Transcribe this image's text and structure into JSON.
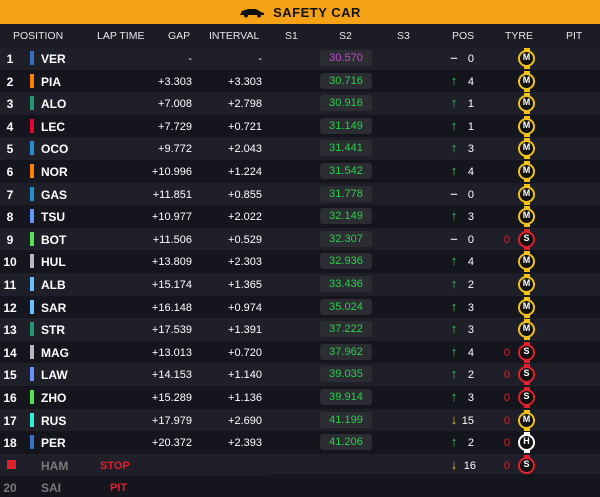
{
  "banner": {
    "icon": "safety-car-icon",
    "title": "SAFETY CAR"
  },
  "header": {
    "position": "POSITION",
    "lap_time": "LAP TIME",
    "gap": "GAP",
    "interval": "INTERVAL",
    "s1": "S1",
    "s2": "S2",
    "s3": "S3",
    "pos": "POS",
    "tyre": "TYRE",
    "pit": "PIT"
  },
  "colors": {
    "banner": "#f5a216",
    "purple": "#c24ad6",
    "green": "#29d14b",
    "medium": "#f2c21b",
    "soft": "#e0202a",
    "hard": "#ffffff"
  },
  "rows": [
    {
      "pos": "1",
      "driver": "VER",
      "team_color": "#3671c6",
      "gap": "-",
      "interval": "-",
      "s2": "30.570",
      "s2_type": "purple",
      "arrow": "none",
      "pos_change": "0",
      "tyre": "M",
      "tyre_age": ""
    },
    {
      "pos": "2",
      "driver": "PIA",
      "team_color": "#ff8000",
      "gap": "+3.303",
      "interval": "+3.303",
      "s2": "30.716",
      "s2_type": "green",
      "arrow": "up",
      "pos_change": "4",
      "tyre": "M",
      "tyre_age": ""
    },
    {
      "pos": "3",
      "driver": "ALO",
      "team_color": "#229971",
      "gap": "+7.008",
      "interval": "+2.798",
      "s2": "30.916",
      "s2_type": "green",
      "arrow": "up",
      "pos_change": "1",
      "tyre": "M",
      "tyre_age": ""
    },
    {
      "pos": "4",
      "driver": "LEC",
      "team_color": "#e8002d",
      "gap": "+7.729",
      "interval": "+0.721",
      "s2": "31.149",
      "s2_type": "green",
      "arrow": "up",
      "pos_change": "1",
      "tyre": "M",
      "tyre_age": ""
    },
    {
      "pos": "5",
      "driver": "OCO",
      "team_color": "#2293d1",
      "gap": "+9.772",
      "interval": "+2.043",
      "s2": "31.441",
      "s2_type": "green",
      "arrow": "up",
      "pos_change": "3",
      "tyre": "M",
      "tyre_age": ""
    },
    {
      "pos": "6",
      "driver": "NOR",
      "team_color": "#ff8000",
      "gap": "+10.996",
      "interval": "+1.224",
      "s2": "31.542",
      "s2_type": "green",
      "arrow": "up",
      "pos_change": "4",
      "tyre": "M",
      "tyre_age": ""
    },
    {
      "pos": "7",
      "driver": "GAS",
      "team_color": "#2293d1",
      "gap": "+11.851",
      "interval": "+0.855",
      "s2": "31.778",
      "s2_type": "green",
      "arrow": "none",
      "pos_change": "0",
      "tyre": "M",
      "tyre_age": ""
    },
    {
      "pos": "8",
      "driver": "TSU",
      "team_color": "#6692ff",
      "gap": "+10.977",
      "interval": "+2.022",
      "s2": "32.149",
      "s2_type": "green",
      "arrow": "up",
      "pos_change": "3",
      "tyre": "M",
      "tyre_age": ""
    },
    {
      "pos": "9",
      "driver": "BOT",
      "team_color": "#52e252",
      "gap": "+11.506",
      "interval": "+0.529",
      "s2": "32.307",
      "s2_type": "green",
      "arrow": "none",
      "pos_change": "0",
      "tyre": "S",
      "tyre_age": "0"
    },
    {
      "pos": "10",
      "driver": "HUL",
      "team_color": "#b6babd",
      "gap": "+13.809",
      "interval": "+2.303",
      "s2": "32.936",
      "s2_type": "green",
      "arrow": "up",
      "pos_change": "4",
      "tyre": "M",
      "tyre_age": ""
    },
    {
      "pos": "11",
      "driver": "ALB",
      "team_color": "#64c4ff",
      "gap": "+15.174",
      "interval": "+1.365",
      "s2": "33.436",
      "s2_type": "green",
      "arrow": "up",
      "pos_change": "2",
      "tyre": "M",
      "tyre_age": ""
    },
    {
      "pos": "12",
      "driver": "SAR",
      "team_color": "#64c4ff",
      "gap": "+16.148",
      "interval": "+0.974",
      "s2": "35.024",
      "s2_type": "green",
      "arrow": "up",
      "pos_change": "3",
      "tyre": "M",
      "tyre_age": ""
    },
    {
      "pos": "13",
      "driver": "STR",
      "team_color": "#229971",
      "gap": "+17.539",
      "interval": "+1.391",
      "s2": "37.222",
      "s2_type": "green",
      "arrow": "up",
      "pos_change": "3",
      "tyre": "M",
      "tyre_age": ""
    },
    {
      "pos": "14",
      "driver": "MAG",
      "team_color": "#b6babd",
      "gap": "+13.013",
      "interval": "+0.720",
      "s2": "37.962",
      "s2_type": "green",
      "arrow": "up",
      "pos_change": "4",
      "tyre": "S",
      "tyre_age": "0"
    },
    {
      "pos": "15",
      "driver": "LAW",
      "team_color": "#6692ff",
      "gap": "+14.153",
      "interval": "+1.140",
      "s2": "39.035",
      "s2_type": "green",
      "arrow": "up",
      "pos_change": "2",
      "tyre": "S",
      "tyre_age": "0"
    },
    {
      "pos": "16",
      "driver": "ZHO",
      "team_color": "#52e252",
      "gap": "+15.289",
      "interval": "+1.136",
      "s2": "39.914",
      "s2_type": "green",
      "arrow": "up",
      "pos_change": "3",
      "tyre": "S",
      "tyre_age": "0"
    },
    {
      "pos": "17",
      "driver": "RUS",
      "team_color": "#27f4d2",
      "gap": "+17.979",
      "interval": "+2.690",
      "s2": "41.199",
      "s2_type": "green",
      "arrow": "down",
      "pos_change": "15",
      "tyre": "M",
      "tyre_age": "0"
    },
    {
      "pos": "18",
      "driver": "PER",
      "team_color": "#3671c6",
      "gap": "+20.372",
      "interval": "+2.393",
      "s2": "41.206",
      "s2_type": "green",
      "arrow": "up",
      "pos_change": "2",
      "tyre": "H",
      "tyre_age": "0"
    }
  ],
  "out_rows": [
    {
      "pos": "",
      "driver": "HAM",
      "status": "STOP",
      "arrow": "down",
      "pos_change": "16",
      "tyre": "S",
      "tyre_age": "0"
    },
    {
      "pos": "20",
      "driver": "SAI",
      "status": "PIT"
    }
  ]
}
